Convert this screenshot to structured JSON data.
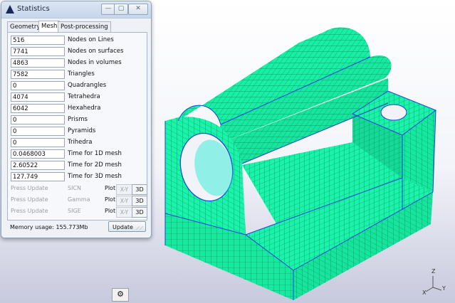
{
  "window": {
    "title": "Statistics",
    "tabs": [
      "Geometry",
      "Mesh",
      "Post-processing"
    ],
    "active_tab": "Mesh",
    "stats": [
      {
        "value": "516",
        "label": "Nodes on Lines"
      },
      {
        "value": "7741",
        "label": "Nodes on surfaces"
      },
      {
        "value": "4863",
        "label": "Nodes in volumes"
      },
      {
        "value": "7582",
        "label": "Triangles"
      },
      {
        "value": "0",
        "label": "Quadrangles"
      },
      {
        "value": "4074",
        "label": "Tetrahedra"
      },
      {
        "value": "6042",
        "label": "Hexahedra"
      },
      {
        "value": "0",
        "label": "Prisms"
      },
      {
        "value": "0",
        "label": "Pyramids"
      },
      {
        "value": "0",
        "label": "Trihedra"
      },
      {
        "value": "0.0468003",
        "label": "Time for 1D mesh"
      },
      {
        "value": "2.60522",
        "label": "Time for 2D mesh"
      },
      {
        "value": "127.749",
        "label": "Time for 3D mesh"
      }
    ],
    "quality": [
      {
        "button": "Press Update",
        "measure": "SICN",
        "plot": "Plot",
        "xy": "X-Y",
        "d3": "3D"
      },
      {
        "button": "Press Update",
        "measure": "Gamma",
        "plot": "Plot",
        "xy": "X-Y",
        "d3": "3D"
      },
      {
        "button": "Press Update",
        "measure": "SIGE",
        "plot": "Plot",
        "xy": "X-Y",
        "d3": "3D"
      }
    ],
    "memory": "Memory usage: 155.773Mb",
    "update_label": "Update",
    "title_buttons": {
      "minimize": "—",
      "maximize": "▢",
      "close": "✕"
    }
  },
  "toolbar": {
    "gear_icon": "⚙"
  },
  "axes": {
    "z": "Z",
    "y": "Y",
    "x": "X"
  },
  "colors": {
    "mesh_fill": "#19f2a8",
    "mesh_line": "#087a55",
    "edge": "#1a3fe0"
  }
}
